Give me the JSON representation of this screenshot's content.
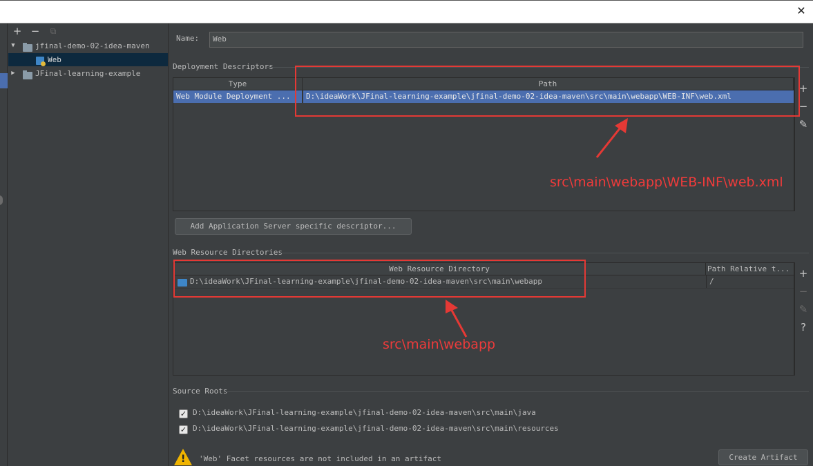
{
  "window": {
    "close_glyph": "✕"
  },
  "tree": {
    "toolbar": [
      {
        "name": "add-icon",
        "glyph": "+"
      },
      {
        "name": "remove-icon",
        "glyph": "−"
      },
      {
        "name": "copy-icon",
        "glyph": "⧉"
      }
    ],
    "items": [
      {
        "label": "jfinal-demo-02-idea-maven",
        "expanded": true
      },
      {
        "label": "Web",
        "selected": true
      },
      {
        "label": "JFinal-learning-example",
        "expanded": false
      }
    ]
  },
  "name_field": {
    "label": "Name:",
    "value": "Web"
  },
  "deployment_descriptors": {
    "title": "Deployment Descriptors",
    "columns": [
      "Type",
      "Path"
    ],
    "rows": [
      {
        "type": "Web Module Deployment ...",
        "path": "D:\\ideaWork\\JFinal-learning-example\\jfinal-demo-02-idea-maven\\src\\main\\webapp\\WEB-INF\\web.xml"
      }
    ],
    "add_server_button": "Add Application Server specific descriptor..."
  },
  "web_resource_directories": {
    "title": "Web Resource Directories",
    "columns": [
      "Web Resource Directory",
      "Path Relative t..."
    ],
    "rows": [
      {
        "directory": "D:\\ideaWork\\JFinal-learning-example\\jfinal-demo-02-idea-maven\\src\\main\\webapp",
        "relative": "/"
      }
    ]
  },
  "side_tools": {
    "add": "+",
    "remove": "−",
    "edit": "✎",
    "help": "?"
  },
  "source_roots": {
    "title": "Source Roots",
    "items": [
      {
        "path": "D:\\ideaWork\\JFinal-learning-example\\jfinal-demo-02-idea-maven\\src\\main\\java",
        "checked": true
      },
      {
        "path": "D:\\ideaWork\\JFinal-learning-example\\jfinal-demo-02-idea-maven\\src\\main\\resources",
        "checked": true
      }
    ]
  },
  "warning": {
    "text": "'Web' Facet resources are not included in an artifact",
    "button": "Create Artifact"
  },
  "annotations": {
    "descriptor_note": "src\\main\\webapp\\WEB-INF\\web.xml",
    "webapp_note": "src\\main\\webapp"
  },
  "colors": {
    "background": "#3c3f41",
    "selection": "#4b6eaf",
    "annotation_red": "#e53935",
    "warning_yellow": "#f0b400"
  }
}
